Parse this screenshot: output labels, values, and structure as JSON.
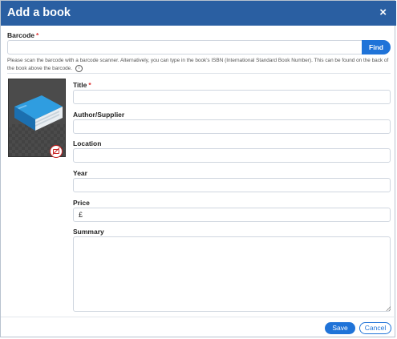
{
  "dialog": {
    "title": "Add a book",
    "close_label": "×"
  },
  "barcode": {
    "label": "Barcode",
    "required_marker": "*",
    "value": "",
    "find_label": "Find",
    "help_text": "Please scan the barcode with a barcode scanner. Alternatively, you can type in the book's ISBN (International Standard Book Number). This can be found on the back of the book above the barcode.",
    "info_icon": "i"
  },
  "cover_image": {
    "icon": "book-icon",
    "overlay_icon": "camera-off-icon"
  },
  "fields": {
    "title": {
      "label": "Title",
      "required_marker": "*",
      "value": ""
    },
    "author": {
      "label": "Author/Supplier",
      "value": ""
    },
    "location": {
      "label": "Location",
      "value": ""
    },
    "year": {
      "label": "Year",
      "value": ""
    },
    "price": {
      "label": "Price",
      "value": "£"
    },
    "summary": {
      "label": "Summary",
      "value": ""
    }
  },
  "footer": {
    "save_label": "Save",
    "cancel_label": "Cancel"
  },
  "colors": {
    "header": "#2a5fa2",
    "primary": "#1f73d8",
    "required": "#dd3333"
  }
}
